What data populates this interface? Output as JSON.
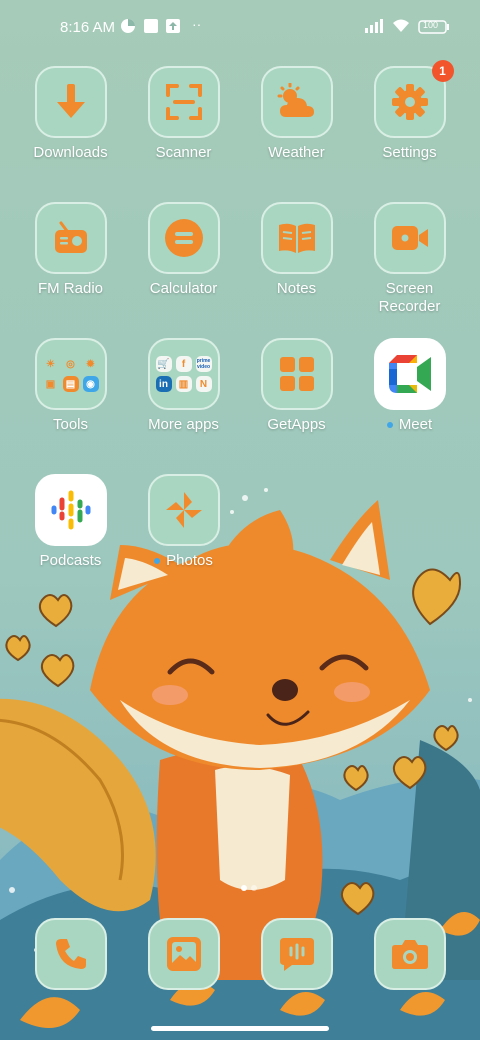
{
  "status": {
    "time": "8:16 AM",
    "battery": "100"
  },
  "apps": [
    {
      "label": "Downloads"
    },
    {
      "label": "Scanner"
    },
    {
      "label": "Weather"
    },
    {
      "label": "Settings",
      "badge": "1"
    },
    {
      "label": "FM Radio"
    },
    {
      "label": "Calculator"
    },
    {
      "label": "Notes"
    },
    {
      "label": "Screen Recorder"
    },
    {
      "label": "Tools"
    },
    {
      "label": "More apps"
    },
    {
      "label": "GetApps"
    },
    {
      "label": "Meet"
    },
    {
      "label": "Podcasts"
    },
    {
      "label": "Photos"
    }
  ],
  "folders": {
    "more_apps": [
      "f",
      "prime video",
      "in",
      "N"
    ]
  },
  "dock": [
    {
      "name": "phone-icon"
    },
    {
      "name": "gallery-icon"
    },
    {
      "name": "messages-icon"
    },
    {
      "name": "camera-icon"
    }
  ],
  "colors": {
    "background": "#a7cdbb",
    "icon_orange": "#f08a2c",
    "tile": "#a9d6c1",
    "badge": "#f2552c"
  }
}
